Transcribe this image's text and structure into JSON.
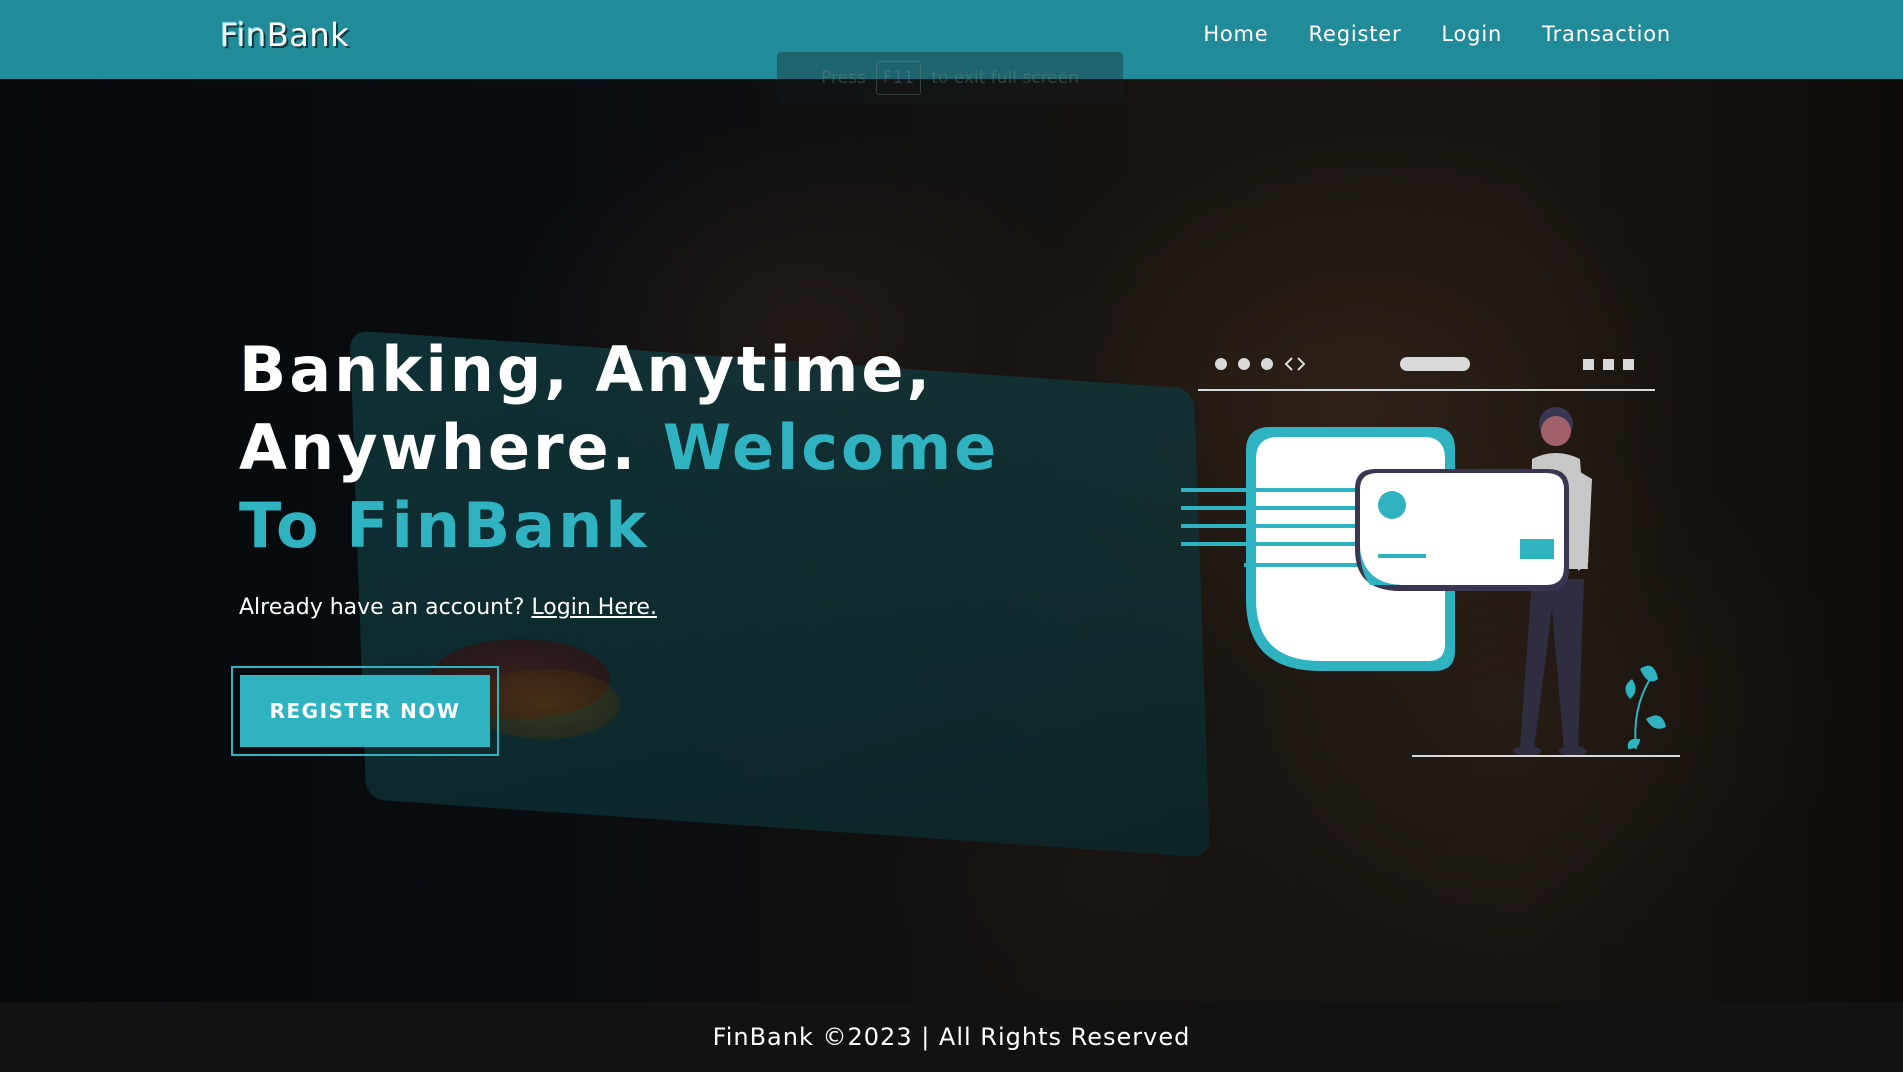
{
  "brand": {
    "part1": "Fin",
    "part2": "Bank"
  },
  "nav": {
    "items": [
      {
        "label": "Home"
      },
      {
        "label": "Register"
      },
      {
        "label": "Login"
      },
      {
        "label": "Transaction"
      }
    ]
  },
  "fullscreen_hint": {
    "prefix": "Press",
    "key": "F11",
    "suffix": "to exit full screen"
  },
  "hero": {
    "headline_white": "Banking, Anytime, Anywhere.",
    "headline_accent": "Welcome To FinBank",
    "subline_text": "Already have an account?",
    "login_link": "Login Here.",
    "register_button": "REGISTER NOW"
  },
  "footer": {
    "text": "FinBank ©2023 | All Rights Reserved"
  },
  "colors": {
    "navbar": "#228b99",
    "accent": "#2fb3c0",
    "footer": "#121212"
  }
}
